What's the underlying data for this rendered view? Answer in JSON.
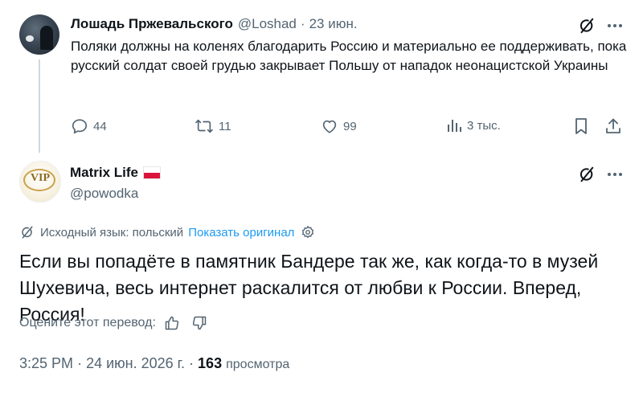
{
  "tweet1": {
    "author_name": "Лошадь Пржевальского",
    "handle": "@Loshad",
    "separator": "·",
    "date": "23 июн.",
    "text": "Поляки должны на коленях благодарить Россию и материально ее поддерживать, пока русский солдат своей грудью закрывает Польшу от нападок неонацистской Украины",
    "replies": "44",
    "reposts": "11",
    "likes": "99",
    "views": "3 тыс."
  },
  "tweet2": {
    "author_name": "Matrix Life",
    "handle": "@powodka",
    "translation_label": "Исходный язык: польский",
    "show_original": "Показать оригинал",
    "text": "Если вы попадёте в памятник Бандере так же, как когда-то в музей Шухевича, весь интернет раскалится от любви к России. Вперед, Россия!",
    "rate_translation": "Оцените этот перевод:",
    "time": "3:25 PM",
    "date": "24 июн. 2026 г.",
    "dot": "·",
    "views_count": "163",
    "views_label": "просмотра",
    "avatar_text": "VIP"
  },
  "colors": {
    "text": "#0f1419",
    "muted": "#536471",
    "link": "#1d9bf0",
    "thread_line": "#cfd9de",
    "flag_red": "#dc143c"
  },
  "icons": [
    "grok-icon",
    "more-icon",
    "reply-icon",
    "repost-icon",
    "like-icon",
    "views-icon",
    "bookmark-icon",
    "share-icon",
    "translate-icon",
    "settings-icon",
    "thumbs-up-icon",
    "thumbs-down-icon",
    "poland-flag-icon"
  ]
}
